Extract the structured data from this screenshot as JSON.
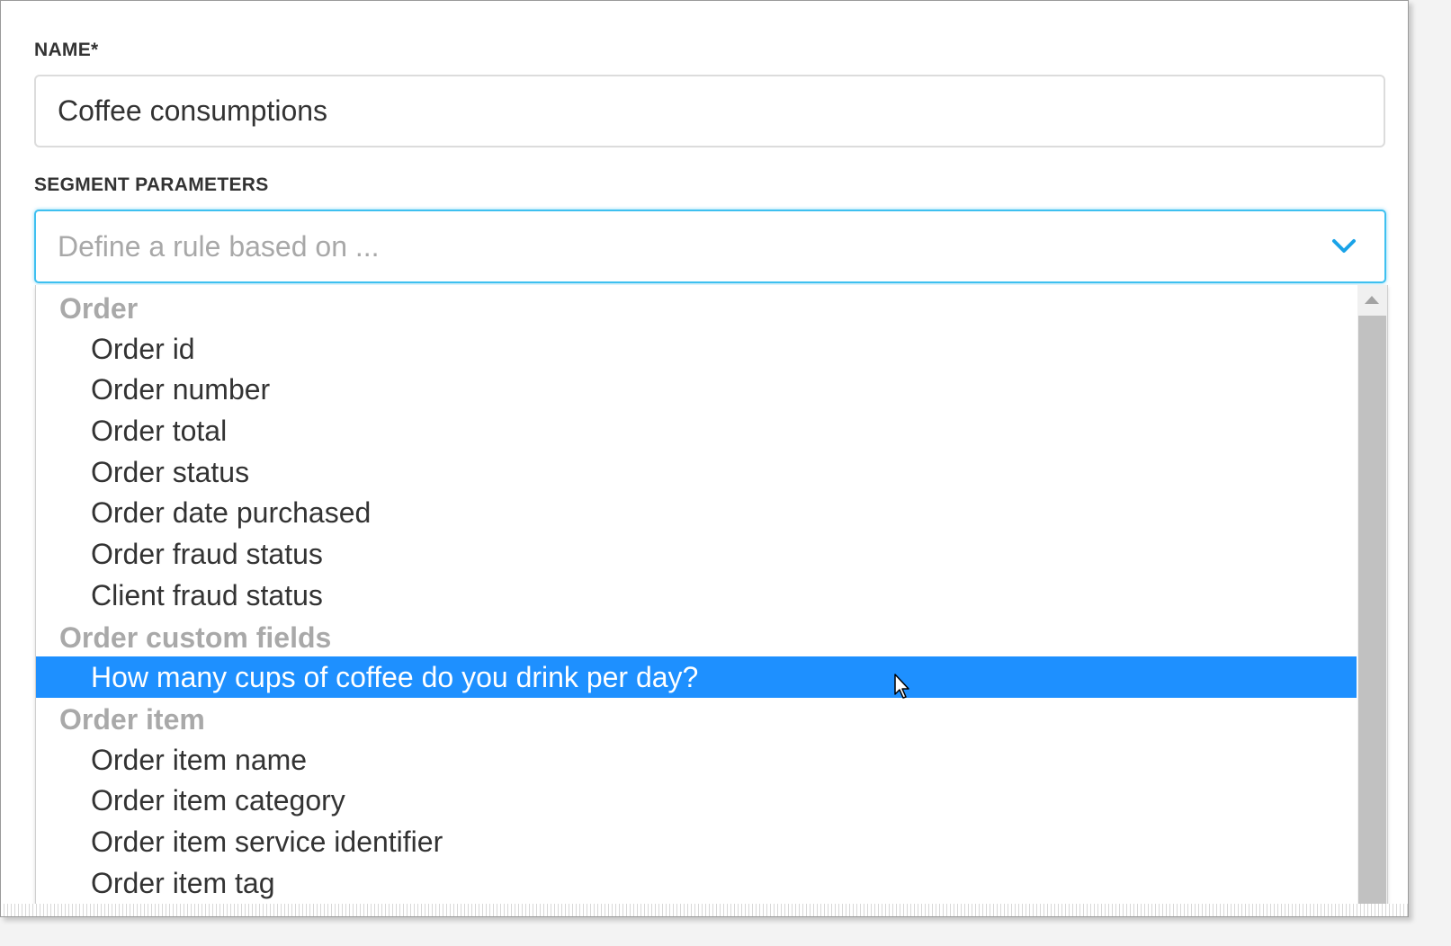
{
  "form": {
    "name_label": "NAME*",
    "name_value": "Coffee consumptions",
    "segment_label": "SEGMENT PARAMETERS",
    "segment_placeholder": "Define a rule based on ..."
  },
  "dropdown": {
    "groups": [
      {
        "label": "Order",
        "options": [
          "Order id",
          "Order number",
          "Order total",
          "Order status",
          "Order date purchased",
          "Order fraud status",
          "Client fraud status"
        ]
      },
      {
        "label": "Order custom fields",
        "options": [
          "How many cups of coffee do you drink per day?"
        ]
      },
      {
        "label": "Order item",
        "options": [
          "Order item name",
          "Order item category",
          "Order item service identifier",
          "Order item tag"
        ]
      }
    ],
    "highlighted_option": "How many cups of coffee do you drink per day?"
  },
  "icons": {
    "select_chevron": "chevron-down-icon",
    "scroll_up": "scroll-up-arrow-icon",
    "pointer": "mouse-cursor-icon"
  },
  "colors": {
    "focus_border": "#3ec0f0",
    "chevron": "#1aa3e8",
    "highlight": "#1e90ff",
    "group_label": "#a9a9a9"
  }
}
